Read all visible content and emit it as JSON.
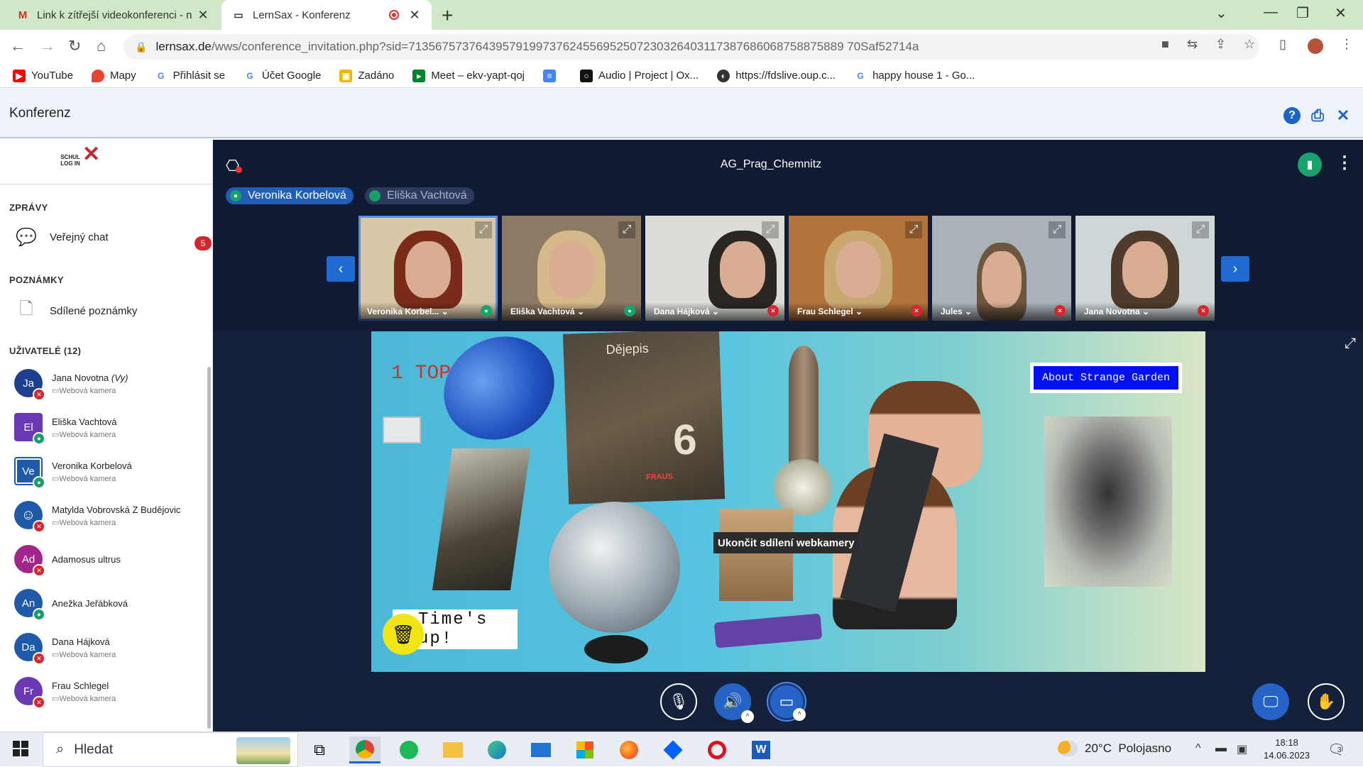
{
  "browser": {
    "tabs": [
      {
        "title": "Link k zítřejší videokonferenci - n",
        "icon": "gmail-icon"
      },
      {
        "title": "LernSax - Konferenz",
        "icon": "laptop-icon"
      }
    ],
    "url": {
      "domain": "lernsax.de",
      "path": "/wws/conference_invitation.php?sid=71356757376439579199737624556952507230326403117387686068758875889 70Saf52714a"
    },
    "bookmarks": [
      {
        "label": "YouTube",
        "color": "#ff0000"
      },
      {
        "label": "Mapy",
        "color": "#ea4335"
      },
      {
        "label": "Přihlásit se",
        "color": "#4285f4"
      },
      {
        "label": "Účet Google",
        "color": "#4285f4"
      },
      {
        "label": "Zadáno",
        "color": "#f4b400"
      },
      {
        "label": "Meet – ekv-yapt-qoj",
        "color": "#00832d"
      },
      {
        "label": "",
        "color": "#4285f4"
      },
      {
        "label": "Audio | Project | Ox...",
        "color": "#111111"
      },
      {
        "label": "https://fdslive.oup.c...",
        "color": "#333333"
      },
      {
        "label": "happy house 1 - Go...",
        "color": "#4285f4"
      }
    ]
  },
  "app": {
    "title": "Konferenz"
  },
  "sidebar": {
    "logo": "SCHUL LOG IN",
    "sections": {
      "messages": "ZPRÁVY",
      "notes": "POZNÁMKY",
      "users": "UŽIVATELÉ (12)"
    },
    "public_chat": "Veřejný chat",
    "chat_badge": "5",
    "shared_notes": "Sdílené poznámky",
    "users": [
      {
        "initials": "Ja",
        "name": "Jana Novotna",
        "suffix": "(Vy)",
        "sub": "Webová kamera",
        "color": "#1c3f8f",
        "status": "red"
      },
      {
        "initials": "El",
        "name": "Eliška Vachtová",
        "suffix": "",
        "sub": "Webová kamera",
        "color": "#6a38b5",
        "status": "green"
      },
      {
        "initials": "Ve",
        "name": "Veronika Korbelová",
        "suffix": "",
        "sub": "Webová kamera",
        "color": "#1e5aa8",
        "status": "green"
      },
      {
        "initials": "☺",
        "name": "Matylda Vobrovská Z Budějovic",
        "suffix": "",
        "sub": "Webová kamera",
        "color": "#1e5aa8",
        "status": "red"
      },
      {
        "initials": "Ad",
        "name": "Adamosus ultrus",
        "suffix": "",
        "sub": "",
        "color": "#a3258a",
        "status": "red"
      },
      {
        "initials": "An",
        "name": "Anežka Jeřábková",
        "suffix": "",
        "sub": "",
        "color": "#1e5aa8",
        "status": "green"
      },
      {
        "initials": "Da",
        "name": "Dana Hájková",
        "suffix": "",
        "sub": "Webová kamera",
        "color": "#1e5aa8",
        "status": "red"
      },
      {
        "initials": "Fr",
        "name": "Frau Schlegel",
        "suffix": "",
        "sub": "Webová kamera",
        "color": "#6a38b5",
        "status": "red"
      }
    ]
  },
  "conference": {
    "room": "AG_Prag_Chemnitz",
    "speakers": [
      "Veronika Korbelová",
      "Eliška Vachtová"
    ],
    "cameras": [
      {
        "label": "Veronika Korbel...",
        "mic": "green",
        "bg": "#d9c8a8",
        "hair": "#7a2b1a"
      },
      {
        "label": "Eliška Vachtová",
        "mic": "green",
        "bg": "#8c7a64",
        "hair": "#d6b98a"
      },
      {
        "label": "Dana Hájková",
        "mic": "red",
        "bg": "#dcdcd8",
        "hair": "#2a2622"
      },
      {
        "label": "Frau Schlegel",
        "mic": "red",
        "bg": "#b3743c",
        "hair": "#c9a770"
      },
      {
        "label": "Jules",
        "mic": "red",
        "bg": "#a9b2b8",
        "hair": "#6d5640"
      },
      {
        "label": "Jana Novotna",
        "mic": "red",
        "bg": "#cfd6d8",
        "hair": "#4f3b2b"
      }
    ],
    "screen": {
      "text_top": "1 TOP",
      "about_button": "About Strange Garden",
      "times_up": "Time's up!",
      "book_title": "Dějepis",
      "book_number": "6",
      "book_publisher": "FRAUS"
    },
    "tooltip": "Ukončit sdílení webkamery"
  },
  "taskbar": {
    "search_placeholder": "Hledat",
    "weather": "20°C  Polojasno",
    "time": "18:18",
    "date": "14.06.2023",
    "notifications": "3"
  }
}
